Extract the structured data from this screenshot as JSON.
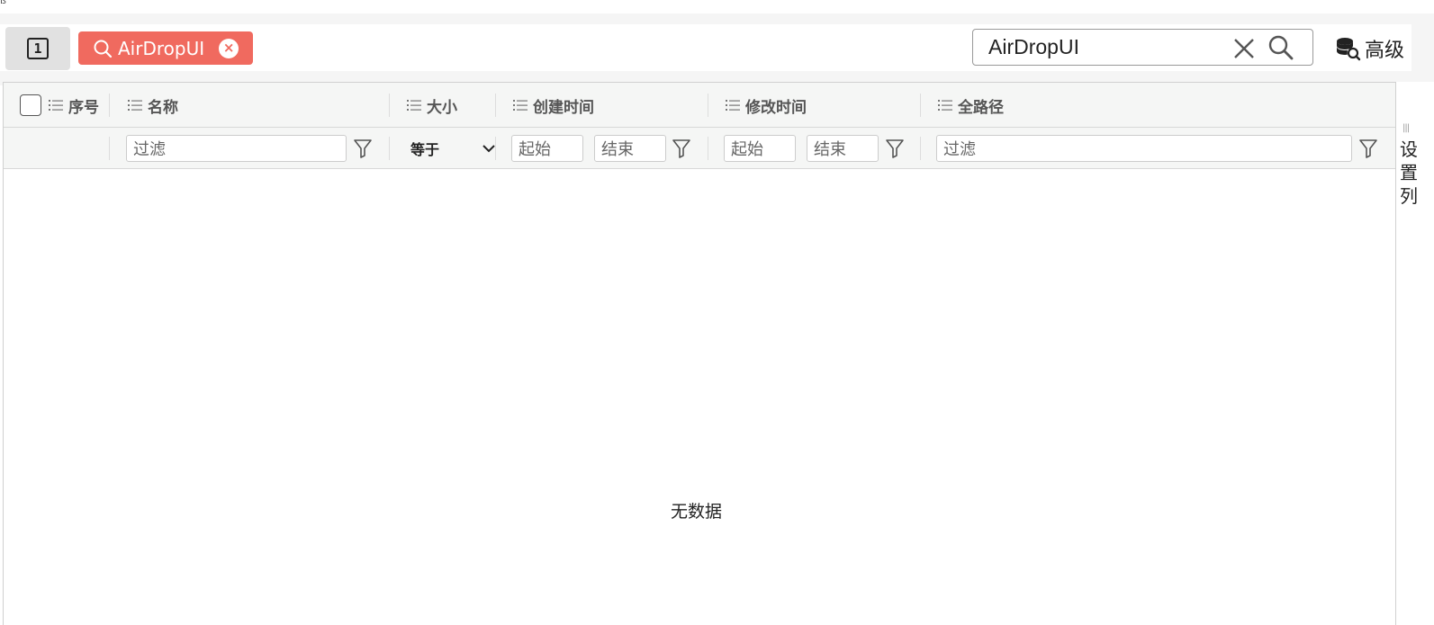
{
  "toolbar": {
    "page_indicator": "1",
    "search_tag": "AirDropUI",
    "search_value": "AirDropUI",
    "advanced_label": "高级"
  },
  "table": {
    "columns": [
      {
        "key": "index",
        "label": "序号"
      },
      {
        "key": "name",
        "label": "名称"
      },
      {
        "key": "size",
        "label": "大小"
      },
      {
        "key": "created",
        "label": "创建时间"
      },
      {
        "key": "modified",
        "label": "修改时间"
      },
      {
        "key": "path",
        "label": "全路径"
      }
    ],
    "filters": {
      "name_placeholder": "过滤",
      "size_operator": "等于",
      "created_start": "起始",
      "created_end": "结束",
      "modified_start": "起始",
      "modified_end": "结束",
      "path_placeholder": "过滤"
    },
    "empty_text": "无数据"
  },
  "side_panel": {
    "label": "设置列"
  },
  "colors": {
    "tag_bg": "#f06a5f",
    "header_bg": "#f5f6f5",
    "page_bg": "#ffffff"
  }
}
